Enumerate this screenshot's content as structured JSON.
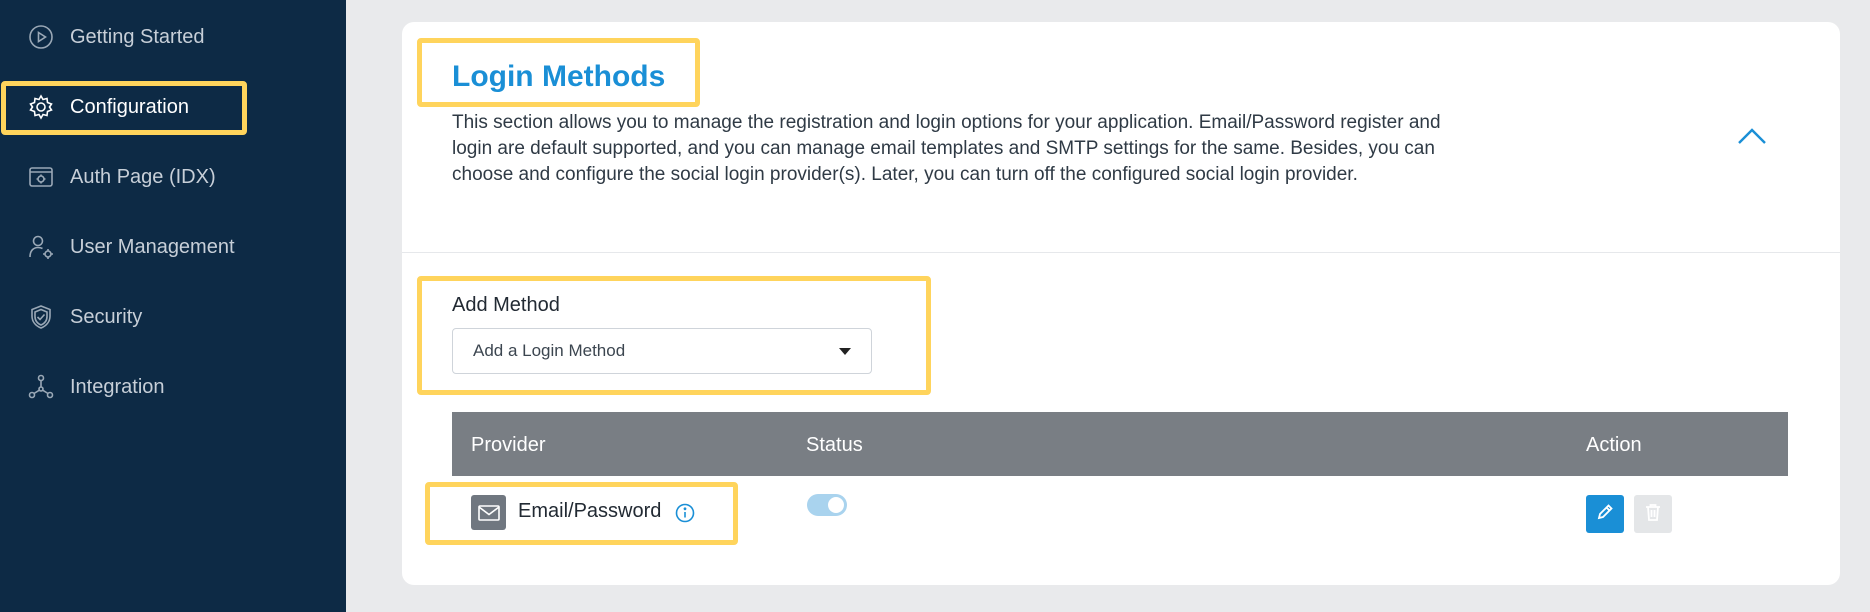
{
  "sidebar": {
    "items": [
      {
        "label": "Getting Started",
        "icon": "play-circle-icon"
      },
      {
        "label": "Configuration",
        "icon": "gear-icon",
        "active": true
      },
      {
        "label": "Auth Page (IDX)",
        "icon": "auth-page-icon"
      },
      {
        "label": "User Management",
        "icon": "user-gear-icon"
      },
      {
        "label": "Security",
        "icon": "shield-icon"
      },
      {
        "label": "Integration",
        "icon": "integration-icon"
      }
    ]
  },
  "section": {
    "title": "Login Methods",
    "description": "This section allows you to manage the registration and login options for your application. Email/Password register and login are default supported, and you can manage email templates and SMTP settings for the same. Besides, you can choose and configure the social login provider(s). Later, you can turn off the configured social login provider."
  },
  "add_method": {
    "label": "Add Method",
    "placeholder": "Add a Login Method"
  },
  "table": {
    "headers": {
      "provider": "Provider",
      "status": "Status",
      "action": "Action"
    },
    "rows": [
      {
        "provider": "Email/Password",
        "icon": "mail-icon",
        "status_enabled": true
      }
    ]
  },
  "colors": {
    "sidebar_bg": "#0d2a45",
    "accent": "#1a8fd6",
    "highlight": "#ffd45c",
    "table_header": "#797e84"
  }
}
